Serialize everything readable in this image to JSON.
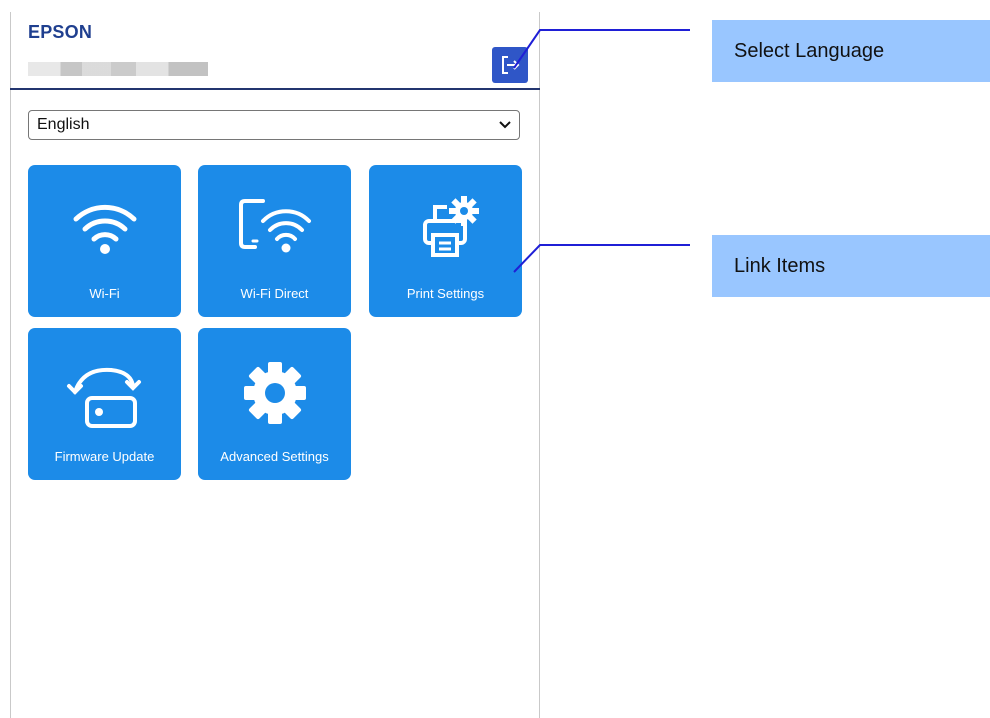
{
  "header": {
    "brand": "EPSON"
  },
  "language": {
    "selected": "English"
  },
  "tiles": [
    {
      "label": "Wi-Fi"
    },
    {
      "label": "Wi-Fi Direct"
    },
    {
      "label": "Print Settings"
    },
    {
      "label": "Firmware Update"
    },
    {
      "label": "Advanced Settings"
    }
  ],
  "callouts": {
    "select_language": "Select Language",
    "link_items": "Link Items"
  },
  "colors": {
    "tile_blue": "#1c8be8",
    "header_rule": "#23356f",
    "logout_button": "#2f56c7",
    "callout_bg": "#99c6ff",
    "connector_line": "#1f1fd6"
  }
}
